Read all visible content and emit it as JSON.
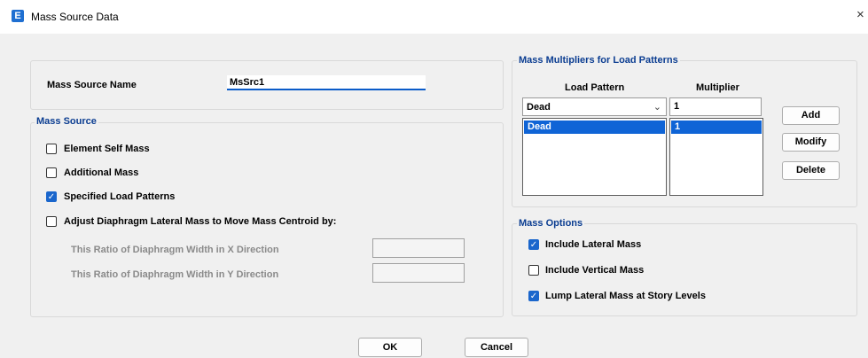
{
  "window": {
    "title": "Mass Source Data",
    "app_icon_letter": "E",
    "close_glyph": "×"
  },
  "mass_source_name": {
    "label": "Mass Source Name",
    "value": "MsSrc1"
  },
  "mass_source": {
    "legend": "Mass Source",
    "options": [
      {
        "label": "Element Self Mass",
        "checked": false
      },
      {
        "label": "Additional Mass",
        "checked": false
      },
      {
        "label": "Specified Load Patterns",
        "checked": true
      },
      {
        "label": "Adjust Diaphragm Lateral Mass to Move Mass Centroid by:",
        "checked": false
      }
    ],
    "ratio_x_label": "This Ratio of Diaphragm Width in X Direction",
    "ratio_y_label": "This Ratio of Diaphragm Width in Y Direction",
    "ratio_x_value": "",
    "ratio_y_value": ""
  },
  "multipliers": {
    "legend": "Mass Multipliers for Load Patterns",
    "col_load_pattern": "Load Pattern",
    "col_multiplier": "Multiplier",
    "selected_pattern": "Dead",
    "multiplier_value": "1",
    "rows": [
      {
        "pattern": "Dead",
        "multiplier": "1"
      }
    ],
    "buttons": {
      "add": "Add",
      "modify": "Modify",
      "delete": "Delete"
    }
  },
  "mass_options": {
    "legend": "Mass Options",
    "options": [
      {
        "label": "Include Lateral Mass",
        "checked": true
      },
      {
        "label": "Include Vertical Mass",
        "checked": false
      },
      {
        "label": "Lump Lateral Mass at Story Levels",
        "checked": true
      }
    ]
  },
  "footer": {
    "ok": "OK",
    "cancel": "Cancel"
  },
  "icons": {
    "check": "✓",
    "dropdown": "chevron-down-icon",
    "check_mark": "check-icon"
  },
  "colors": {
    "accent": "#1a66cc",
    "legend_text": "#0b3d91",
    "selection": "#0f64d6"
  }
}
